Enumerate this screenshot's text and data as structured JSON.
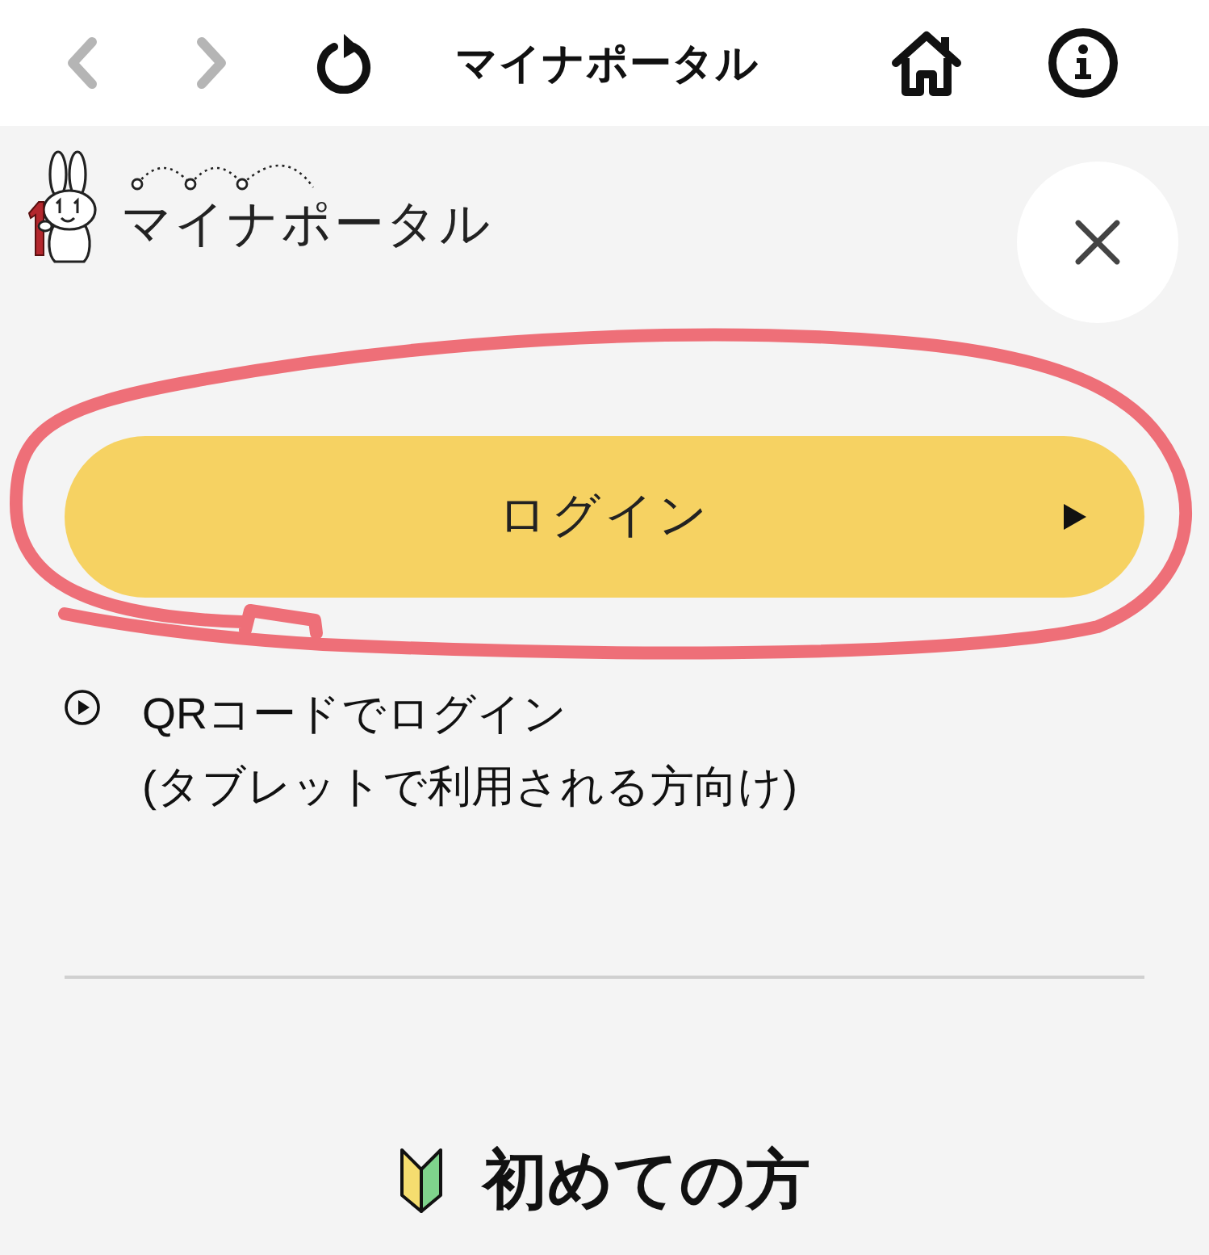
{
  "toolbar": {
    "left_buttons": [
      {
        "kind": "back",
        "disabled": true
      },
      {
        "kind": "forward",
        "disabled": true
      },
      {
        "kind": "reload",
        "disabled": false
      }
    ],
    "title": "マイナポータル",
    "right_buttons": [
      {
        "kind": "home"
      },
      {
        "kind": "info"
      }
    ]
  },
  "logo": {
    "text": "マイナポータル"
  },
  "login_button": {
    "label": "ログイン"
  },
  "qr_login_link": {
    "lines": [
      "QRコードでログイン",
      "(タブレットで利用される方向け)"
    ]
  },
  "first_time": {
    "heading": "初めての方"
  }
}
